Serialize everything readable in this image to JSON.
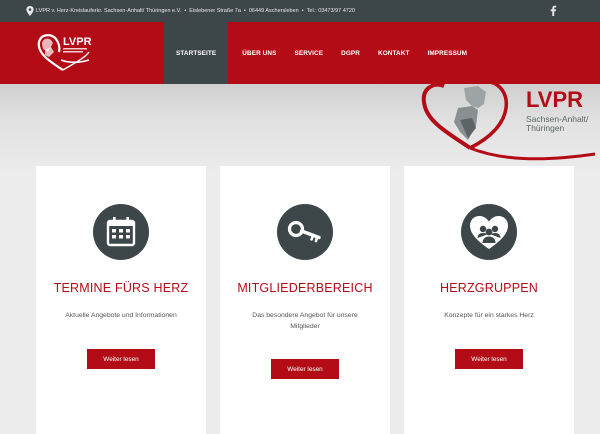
{
  "topbar": {
    "organization": "LVPR v. Herz-Kreislauferkr. Sachsen-Anhalt/ Thüringen e.V.",
    "street": "Eislebener Straße 7a",
    "city": "06449 Aschersleben",
    "phone": "Tel.: 03473/97 4720",
    "separator": "•"
  },
  "brand": {
    "logo_text": "LVPR",
    "hero_name": "LVPR",
    "hero_region_line1": "Sachsen-Anhalt/",
    "hero_region_line2": "Thüringen"
  },
  "nav": {
    "items": [
      {
        "label": "STARTSEITE",
        "active": true
      },
      {
        "label": "ÜBER UNS"
      },
      {
        "label": "SERVICE"
      },
      {
        "label": "DGPR"
      },
      {
        "label": "KONTAKT"
      },
      {
        "label": "IMPRESSUM"
      }
    ]
  },
  "cards": [
    {
      "title": "TERMINE FÜRS HERZ",
      "text": "Aktuelle Angebote und Informationen",
      "button": "Weiter lesen",
      "icon": "calendar-icon"
    },
    {
      "title": "MITGLIEDERBEREICH",
      "text": "Das besondere Angebot für unsere Mitglieder",
      "button": "Weiter lesen",
      "icon": "key-icon"
    },
    {
      "title": "HERZGRUPPEN",
      "text": "Konzepte für ein starkes Herz",
      "button": "Weiter lesen",
      "icon": "heart-group-icon"
    }
  ],
  "icons": {
    "location": "map-pin-icon",
    "social": "facebook-icon"
  },
  "colors": {
    "brand_red": "#b40c17",
    "dark": "#3d4649",
    "background": "#ececec",
    "card": "#ffffff"
  }
}
